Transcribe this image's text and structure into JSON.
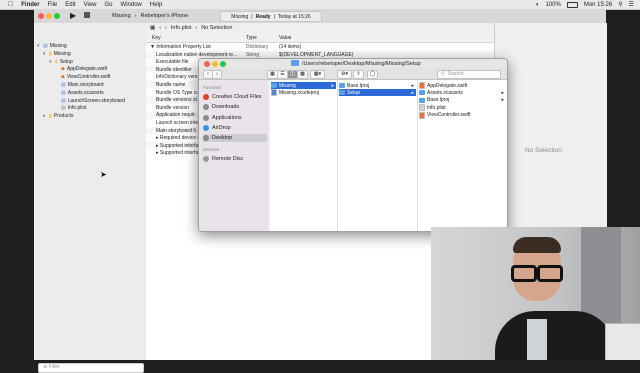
{
  "menubar": {
    "apple": "",
    "items": [
      "Finder",
      "File",
      "Edit",
      "View",
      "Go",
      "Window",
      "Help"
    ],
    "clock": "Mon 15:26",
    "battery": "100%"
  },
  "xcode": {
    "scheme": "Missing",
    "device": "Rebeloper's iPhone",
    "status_project": "Missing",
    "status_state": "Ready",
    "status_time": "Today at 15:26",
    "jumpbar": {
      "file": "Info.plist",
      "selection": "No Selection"
    },
    "navigator": [
      {
        "label": "Missing",
        "kind": "project",
        "depth": 0
      },
      {
        "label": "Missing",
        "kind": "folder",
        "depth": 1
      },
      {
        "label": "Setup",
        "kind": "folder",
        "depth": 2
      },
      {
        "label": "AppDelegate.swift",
        "kind": "swift",
        "depth": 3
      },
      {
        "label": "ViewController.swift",
        "kind": "swift",
        "depth": 3
      },
      {
        "label": "Main.storyboard",
        "kind": "storyboard",
        "depth": 3
      },
      {
        "label": "Assets.xcassets",
        "kind": "assets",
        "depth": 3
      },
      {
        "label": "LaunchScreen.storyboard",
        "kind": "storyboard",
        "depth": 3
      },
      {
        "label": "Info.plist",
        "kind": "plist",
        "depth": 3
      },
      {
        "label": "Products",
        "kind": "folder",
        "depth": 1
      }
    ],
    "filter_placeholder": "Filter",
    "plist_header": {
      "key": "Key",
      "type": "Type",
      "value": "Value"
    },
    "plist_rows": [
      {
        "key": "▼ Information Property List",
        "type": "Dictionary",
        "value": "(14 items)"
      },
      {
        "key": "Localization native development re…",
        "type": "String",
        "value": "$(DEVELOPMENT_LANGUAGE)"
      },
      {
        "key": "Executable file",
        "type": "",
        "value": ""
      },
      {
        "key": "Bundle identifier",
        "type": "",
        "value": ""
      },
      {
        "key": "InfoDictionary vers…",
        "type": "",
        "value": ""
      },
      {
        "key": "Bundle name",
        "type": "",
        "value": ""
      },
      {
        "key": "Bundle OS Type co…",
        "type": "",
        "value": ""
      },
      {
        "key": "Bundle versions st…",
        "type": "",
        "value": ""
      },
      {
        "key": "Bundle version",
        "type": "",
        "value": ""
      },
      {
        "key": "Application requir…",
        "type": "",
        "value": ""
      },
      {
        "key": "Launch screen inte…",
        "type": "",
        "value": ""
      },
      {
        "key": "Main storyboard fi…",
        "type": "",
        "value": ""
      },
      {
        "key": "▸ Required device ca…",
        "type": "",
        "value": ""
      },
      {
        "key": "▸ Supported interfac…",
        "type": "",
        "value": ""
      },
      {
        "key": "▸ Supported interfac…",
        "type": "",
        "value": ""
      }
    ],
    "inspector_empty": "No Selection"
  },
  "finder": {
    "path": "/Users/rebeloper/Desktop/Missing/Missing/Setup",
    "search_placeholder": "Search",
    "sidebar": {
      "favorites_label": "Favorites",
      "favorites": [
        {
          "label": "Creative Cloud Files",
          "color": "#e23b2e"
        },
        {
          "label": "Downloads",
          "color": "#8a8a8a"
        },
        {
          "label": "Applications",
          "color": "#8a8a8a"
        },
        {
          "label": "AirDrop",
          "color": "#3c8ee8"
        },
        {
          "label": "Desktop",
          "color": "#8a8a8a"
        }
      ],
      "devices_label": "Devices",
      "devices": [
        {
          "label": "Remote Disc",
          "color": "#9a9a9a"
        }
      ]
    },
    "col1": [
      "Missing",
      "Missing.xcodeproj"
    ],
    "col2": [
      "Base.lproj",
      "Setup"
    ],
    "col3": [
      "AppDelegate.swift",
      "Assets.xcassets",
      "Base.lproj",
      "Info.plist",
      "ViewController.swift"
    ]
  },
  "colors": {
    "selection": "#2d6ad8",
    "folder": "#5aa0e8"
  }
}
